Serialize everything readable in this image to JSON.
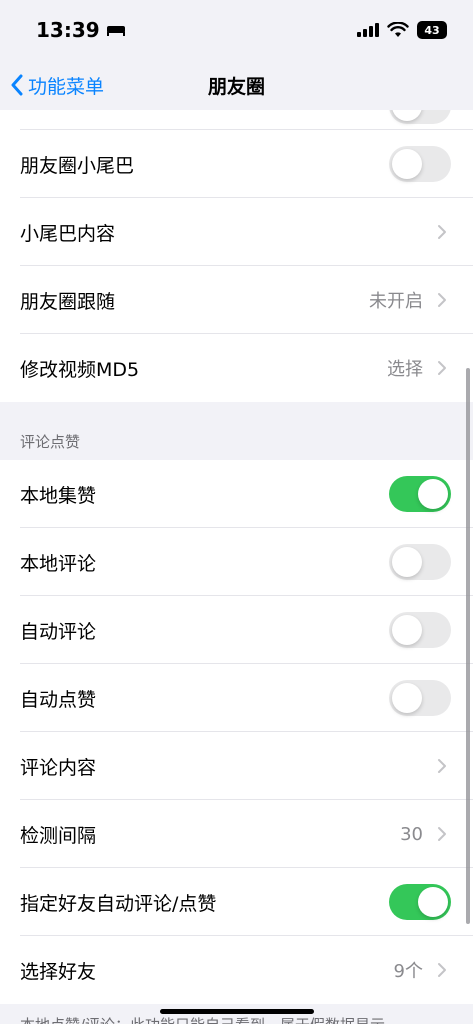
{
  "status_bar": {
    "time": "13:39",
    "battery": "43"
  },
  "nav": {
    "back_label": "功能菜单",
    "title": "朋友圈"
  },
  "group1": [
    {
      "label": "朋友圈小尾巴",
      "type": "toggle",
      "on": false
    },
    {
      "label": "小尾巴内容",
      "type": "link",
      "value": ""
    },
    {
      "label": "朋友圈跟随",
      "type": "link",
      "value": "未开启"
    },
    {
      "label": "修改视频MD5",
      "type": "link",
      "value": "选择"
    }
  ],
  "section2": {
    "header": "评论点赞",
    "items": [
      {
        "label": "本地集赞",
        "type": "toggle",
        "on": true
      },
      {
        "label": "本地评论",
        "type": "toggle",
        "on": false
      },
      {
        "label": "自动评论",
        "type": "toggle",
        "on": false
      },
      {
        "label": "自动点赞",
        "type": "toggle",
        "on": false
      },
      {
        "label": "评论内容",
        "type": "link",
        "value": ""
      },
      {
        "label": "检测间隔",
        "type": "link",
        "value": "30"
      },
      {
        "label": "指定好友自动评论/点赞",
        "type": "toggle",
        "on": true
      },
      {
        "label": "选择好友",
        "type": "link",
        "value": "9个"
      }
    ]
  },
  "footer_note": "本地点赞/评论：此功能只能自己看到，属于假数据显示",
  "colors": {
    "accent": "#0a84ff",
    "toggle_on": "#34c759",
    "toggle_off": "#e9e9ea"
  }
}
